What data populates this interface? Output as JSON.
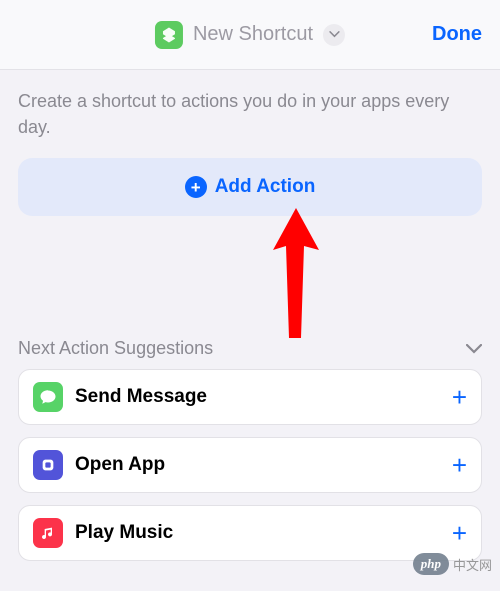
{
  "header": {
    "title": "New Shortcut",
    "done_label": "Done"
  },
  "description": "Create a shortcut to actions you do in your apps every day.",
  "add_action_label": "Add Action",
  "suggestions": {
    "title": "Next Action Suggestions",
    "items": [
      {
        "label": "Send Message",
        "icon": "message"
      },
      {
        "label": "Open App",
        "icon": "openapp"
      },
      {
        "label": "Play Music",
        "icon": "music"
      }
    ]
  },
  "watermark": {
    "badge": "php",
    "text": "中文网"
  }
}
